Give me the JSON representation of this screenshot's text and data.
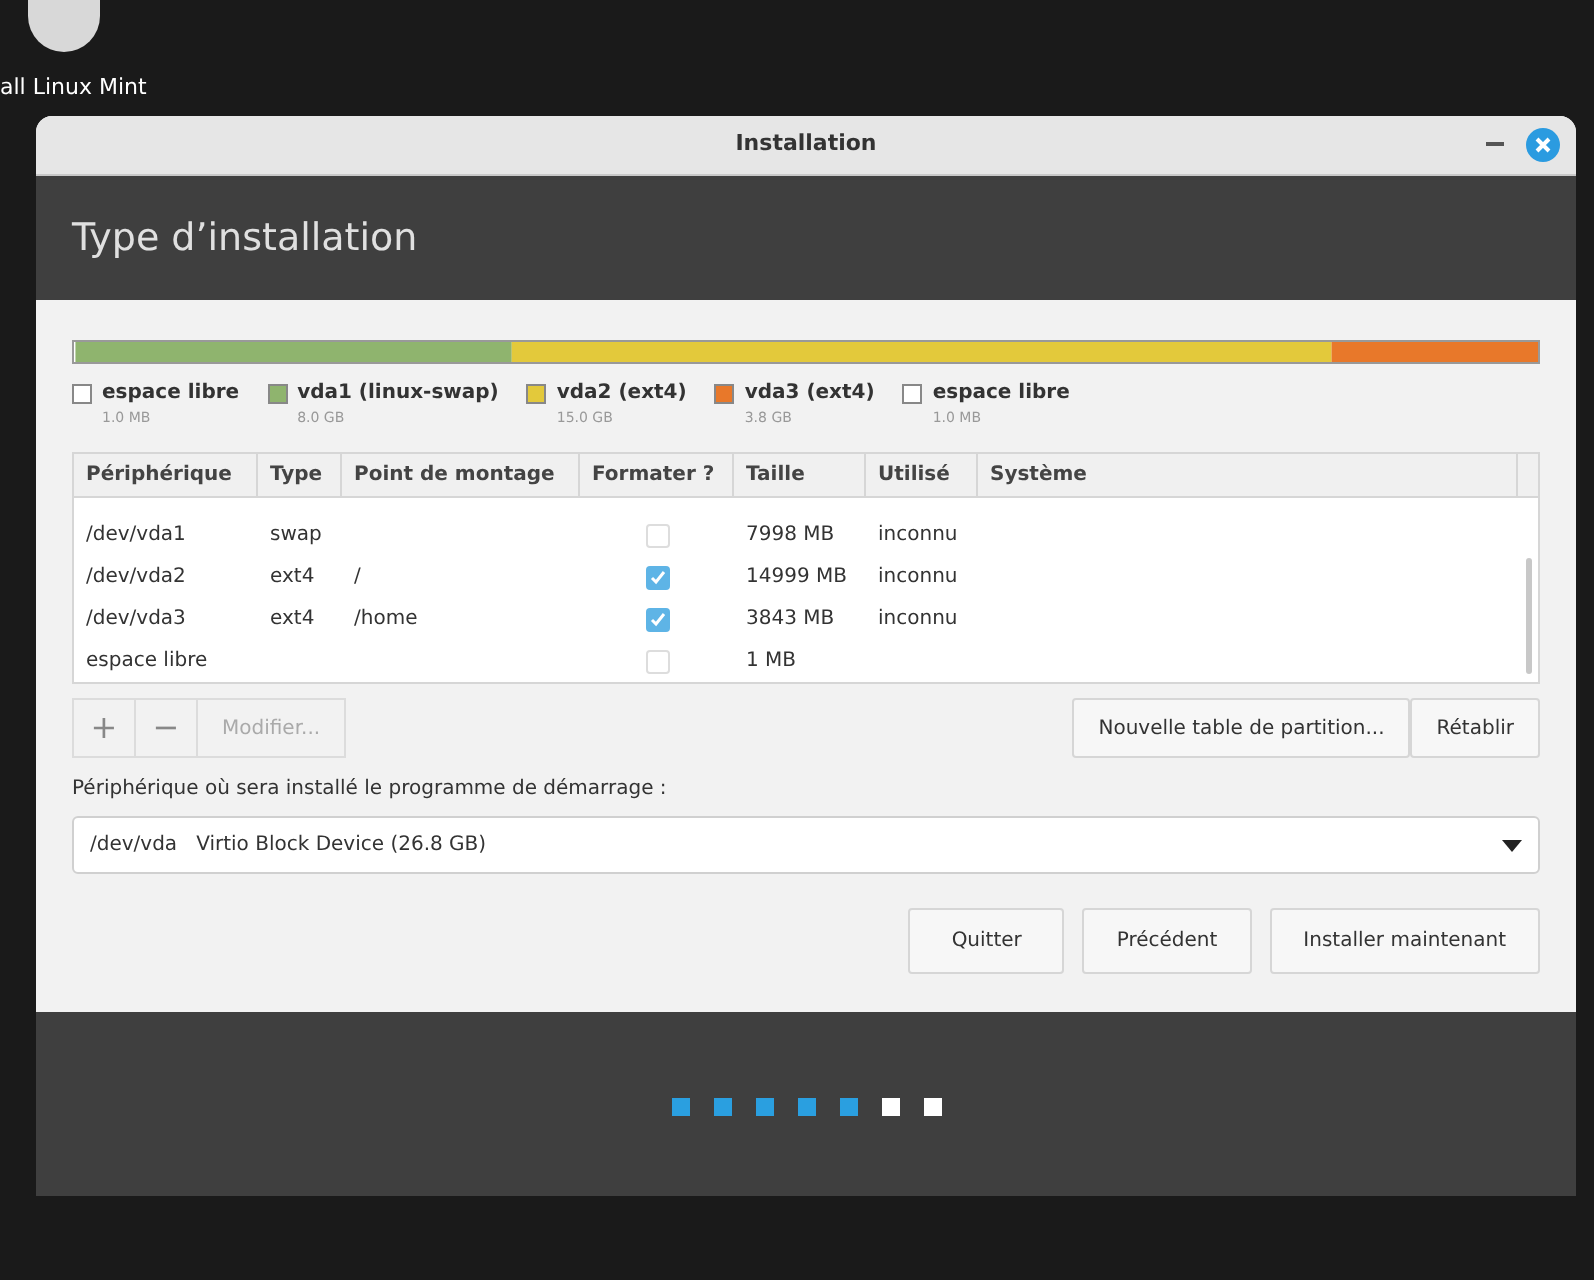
{
  "desktop_icon": {
    "label": "all Linux Mint"
  },
  "window": {
    "title": "Installation"
  },
  "header": {
    "title": "Type d’installation"
  },
  "partition_legend": [
    {
      "name": "espace libre",
      "size": "1.0 MB",
      "color": "#ffffff"
    },
    {
      "name": "vda1 (linux-swap)",
      "size": "8.0 GB",
      "color": "#8fb46e"
    },
    {
      "name": "vda2 (ext4)",
      "size": "15.0 GB",
      "color": "#e3c93b"
    },
    {
      "name": "vda3 (ext4)",
      "size": "3.8 GB",
      "color": "#e8782a"
    },
    {
      "name": "espace libre",
      "size": "1.0 MB",
      "color": "#ffffff"
    }
  ],
  "table": {
    "columns": [
      "Périphérique",
      "Type",
      "Point de montage",
      "Formater ?",
      "Taille",
      "Utilisé",
      "Système"
    ],
    "rows": [
      {
        "device": "/dev/vda1",
        "type": "swap",
        "mount": "",
        "format": false,
        "size": "7998 MB",
        "used": "inconnu"
      },
      {
        "device": "/dev/vda2",
        "type": "ext4",
        "mount": "/",
        "format": true,
        "size": "14999 MB",
        "used": "inconnu"
      },
      {
        "device": "/dev/vda3",
        "type": "ext4",
        "mount": "/home",
        "format": true,
        "size": "3843 MB",
        "used": "inconnu"
      },
      {
        "device": "espace libre",
        "type": "",
        "mount": "",
        "format": false,
        "size": "1 MB",
        "used": ""
      }
    ]
  },
  "partition_buttons": {
    "add": "+",
    "remove": "−",
    "modify": {
      "label": "Modifier...",
      "disabled": true
    }
  },
  "table_buttons": [
    "Nouvelle table de partition...",
    "Rétablir"
  ],
  "bootloader": {
    "label": "Périphérique où sera installé le programme de démarrage :",
    "device": "/dev/vda",
    "description": "Virtio Block Device (26.8 GB)"
  },
  "buttons": [
    "Quitter",
    "Précédent",
    "Installer maintenant"
  ],
  "progress_steps": [
    {
      "done": true
    },
    {
      "done": true
    },
    {
      "done": true
    },
    {
      "done": true
    },
    {
      "done": true
    },
    {
      "done": false
    },
    {
      "done": false
    }
  ]
}
